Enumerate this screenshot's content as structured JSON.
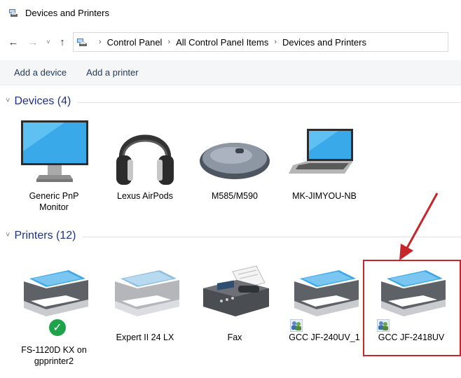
{
  "window": {
    "title": "Devices and Printers"
  },
  "address": {
    "crumbs": [
      "Control Panel",
      "All Control Panel Items",
      "Devices and Printers"
    ],
    "separator": "›"
  },
  "nav": {
    "back": "←",
    "forward": "→",
    "recent": "˅",
    "up": "↑"
  },
  "commands": [
    "Add a device",
    "Add a printer"
  ],
  "groups": {
    "devices": {
      "chevron": "˅",
      "title": "Devices (4)"
    },
    "printers": {
      "chevron": "˅",
      "title": "Printers (12)"
    }
  },
  "devices": [
    {
      "icon": "monitor-icon",
      "label_lines": [
        "Generic PnP",
        "Monitor"
      ]
    },
    {
      "icon": "headphones-icon",
      "label_lines": [
        "Lexus AirPods"
      ]
    },
    {
      "icon": "mouse-icon",
      "label_lines": [
        "M585/M590"
      ]
    },
    {
      "icon": "laptop-icon",
      "label_lines": [
        "MK-JIMYOU-NB"
      ]
    }
  ],
  "printers": [
    {
      "icon": "printer-icon",
      "label_lines": [
        "FS-1120D KX on",
        "gpprinter2"
      ],
      "status": "default-check"
    },
    {
      "icon": "printer-icon",
      "label_lines": [
        "Expert II 24 LX"
      ]
    },
    {
      "icon": "fax-icon",
      "label_lines": [
        "Fax"
      ]
    },
    {
      "icon": "printer-icon",
      "label_lines": [
        "GCC JF-240UV_1"
      ],
      "shared": true
    },
    {
      "icon": "printer-icon",
      "label_lines": [
        "GCC JF-2418UV"
      ],
      "shared": true,
      "highlighted": true
    }
  ],
  "colors": {
    "group_title": "#1e3287",
    "highlight": "#c6262b",
    "arrow": "#c6262b",
    "status_ok": "#1fa34a"
  }
}
